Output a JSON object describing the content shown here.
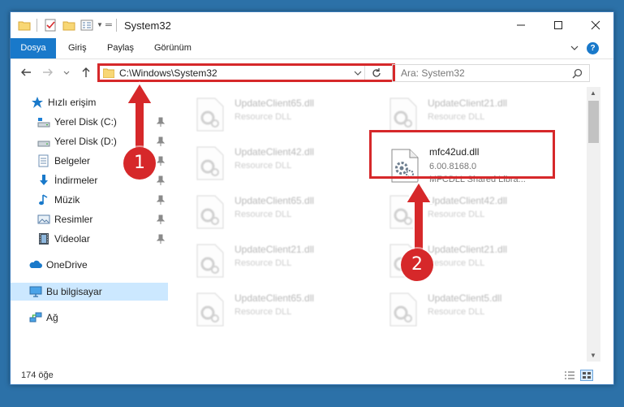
{
  "window": {
    "title": "System32"
  },
  "ribbon": {
    "tabs": [
      {
        "label": "Dosya"
      },
      {
        "label": "Giriş"
      },
      {
        "label": "Paylaş"
      },
      {
        "label": "Görünüm"
      }
    ],
    "help": "?"
  },
  "navigation": {
    "address": "C:\\Windows\\System32",
    "search_placeholder": "Ara: System32"
  },
  "sidebar": {
    "items": [
      {
        "label": "Hızlı erişim",
        "icon": "star-icon"
      },
      {
        "label": "Yerel Disk (C:)",
        "icon": "drive-icon",
        "pinned": true
      },
      {
        "label": "Yerel Disk (D:)",
        "icon": "drive-icon",
        "pinned": true
      },
      {
        "label": "Belgeler",
        "icon": "documents-icon",
        "pinned": true
      },
      {
        "label": "İndirmeler",
        "icon": "downloads-icon",
        "pinned": true
      },
      {
        "label": "Müzik",
        "icon": "music-icon",
        "pinned": true
      },
      {
        "label": "Resimler",
        "icon": "pictures-icon",
        "pinned": true
      },
      {
        "label": "Videolar",
        "icon": "videos-icon",
        "pinned": true
      },
      {
        "label": "OneDrive",
        "icon": "cloud-icon"
      },
      {
        "label": "Bu bilgisayar",
        "icon": "computer-icon",
        "selected": true
      },
      {
        "label": "Ağ",
        "icon": "network-icon"
      }
    ]
  },
  "files": [
    {
      "name": "UpdateClient65.dll",
      "desc": "Resource DLL"
    },
    {
      "name": "UpdateClient21.dll",
      "desc": "Resource DLL"
    },
    {
      "name": "UpdateClient42.dll",
      "desc": "Resource DLL"
    },
    {
      "name": "mfc42ud.dll",
      "version": "6.00.8168.0",
      "desc": "MFCDLL Shared Libra...",
      "highlighted": true
    },
    {
      "name": "UpdateClient65.dll",
      "desc": "Resource DLL"
    },
    {
      "name": "UpdateClient42.dll",
      "desc": "Resource DLL"
    },
    {
      "name": "UpdateClient21.dll",
      "desc": "Resource DLL"
    },
    {
      "name": "UpdateClient21.dll",
      "desc": "Resource DLL"
    },
    {
      "name": "UpdateClient65.dll",
      "desc": "Resource DLL"
    },
    {
      "name": "UpdateClient5.dll",
      "desc": "Resource DLL"
    }
  ],
  "status": {
    "item_count": "174 öğe"
  },
  "annotations": {
    "step1": "1",
    "step2": "2"
  },
  "colors": {
    "accent": "#1979ca",
    "highlight_red": "#d6282a",
    "selected_bg": "#cce8ff"
  }
}
